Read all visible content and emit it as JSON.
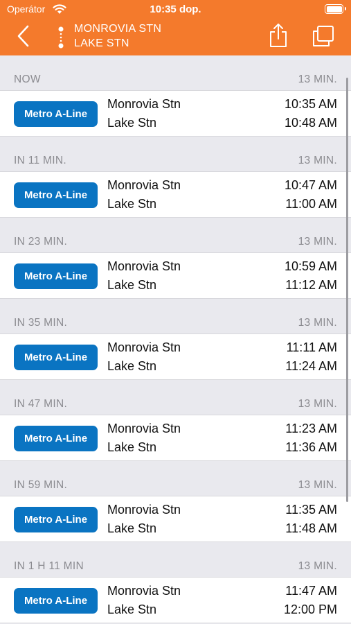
{
  "status": {
    "carrier": "Operátor",
    "time": "10:35 dop."
  },
  "header": {
    "from": "MONROVIA STN",
    "to": "LAKE STN"
  },
  "theme": {
    "accent": "#f47a2c",
    "badge": "#0a74c2"
  },
  "trips": [
    {
      "when": "NOW",
      "duration": "13 MIN.",
      "line": "Metro A-Line",
      "from": "Monrovia Stn",
      "to": "Lake Stn",
      "depart": "10:35 AM",
      "arrive": "10:48 AM"
    },
    {
      "when": "IN 11 MIN.",
      "duration": "13 MIN.",
      "line": "Metro A-Line",
      "from": "Monrovia Stn",
      "to": "Lake Stn",
      "depart": "10:47 AM",
      "arrive": "11:00 AM"
    },
    {
      "when": "IN 23 MIN.",
      "duration": "13 MIN.",
      "line": "Metro A-Line",
      "from": "Monrovia Stn",
      "to": "Lake Stn",
      "depart": "10:59 AM",
      "arrive": "11:12 AM"
    },
    {
      "when": "IN 35 MIN.",
      "duration": "13 MIN.",
      "line": "Metro A-Line",
      "from": "Monrovia Stn",
      "to": "Lake Stn",
      "depart": "11:11 AM",
      "arrive": "11:24 AM"
    },
    {
      "when": "IN 47 MIN.",
      "duration": "13 MIN.",
      "line": "Metro A-Line",
      "from": "Monrovia Stn",
      "to": "Lake Stn",
      "depart": "11:23 AM",
      "arrive": "11:36 AM"
    },
    {
      "when": "IN 59 MIN.",
      "duration": "13 MIN.",
      "line": "Metro A-Line",
      "from": "Monrovia Stn",
      "to": "Lake Stn",
      "depart": "11:35 AM",
      "arrive": "11:48 AM"
    },
    {
      "when": "IN 1 H 11 MIN",
      "duration": "13 MIN.",
      "line": "Metro A-Line",
      "from": "Monrovia Stn",
      "to": "Lake Stn",
      "depart": "11:47 AM",
      "arrive": "12:00 PM"
    }
  ]
}
